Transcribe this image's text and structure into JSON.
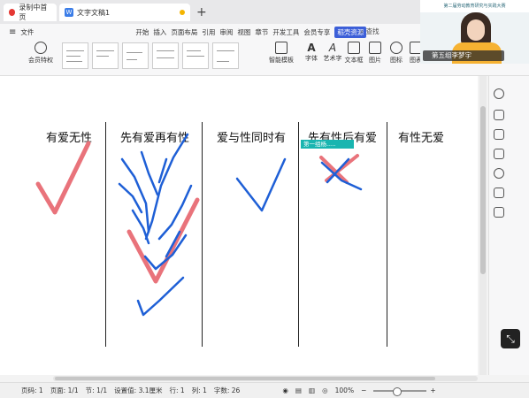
{
  "tabs": {
    "recording": "录制中首页",
    "document": "文字文稿1",
    "add": "+"
  },
  "menu": {
    "file": "文件",
    "items": [
      "开始",
      "插入",
      "页面布局",
      "引用",
      "审阅",
      "视图",
      "章节",
      "开发工具",
      "会员专享",
      "稻壳资源"
    ],
    "search": "查找"
  },
  "ribbon": {
    "member": "会员特权",
    "smart_template": "智能模板",
    "buttons": [
      "字体",
      "艺术字",
      "文本框",
      "图片",
      "图标",
      "图表"
    ]
  },
  "headings": [
    "有爱无性",
    "先有爱再有性",
    "爱与性同时有",
    "先有性后有爱",
    "有性无爱"
  ],
  "tooltip": "第一组杨.....",
  "video": {
    "name": "第五组李梦宇",
    "banner": "第二届劳动教育研究与实践大赛"
  },
  "status": {
    "page_code": "页码: 1",
    "pages": "页面: 1/1",
    "section": "节: 1/1",
    "setting": "设置值: 3.1厘米",
    "row": "行: 1",
    "col": "列: 1",
    "words": "字数: 26",
    "zoom": "100%"
  },
  "colors": {
    "pen_blue": "#1e5fd6",
    "pen_red": "#e9737b",
    "accent": "#3c5fd8"
  }
}
